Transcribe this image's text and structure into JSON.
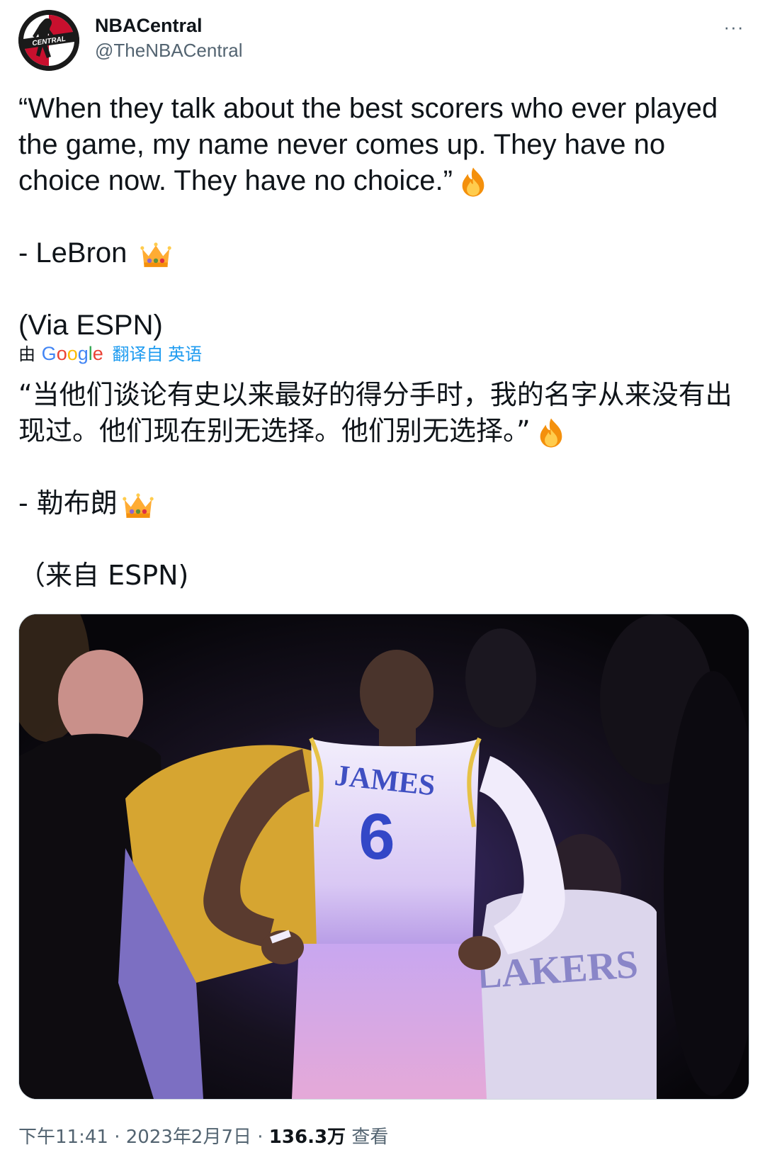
{
  "author": {
    "display_name": "NBACentral",
    "handle": "@TheNBACentral",
    "avatar_text": "CENTRAL"
  },
  "more_label": "···",
  "tweet": {
    "quote": "“When they talk about the best scorers who ever played the game, my name never comes up. They have no choice now. They have no choice.”",
    "attribution": "- LeBron",
    "source": "(Via ESPN)"
  },
  "translation": {
    "prefix": "由",
    "google": [
      "G",
      "o",
      "o",
      "g",
      "l",
      "e"
    ],
    "link": "翻译自 英语",
    "quote": "“当他们谈论有史以来最好的得分手时，我的名字从来没有出现过。他们现在别无选择。他们别无选择。”",
    "attribution": "- 勒布朗",
    "source": "（来自 ESPN)"
  },
  "media": {
    "jersey_name": "JAMES",
    "jersey_number": "6",
    "second_jersey_text": "LAKERS"
  },
  "meta": {
    "time": "下午11:41",
    "date": "2023年2月7日",
    "views_count": "136.3万",
    "views_label": "查看"
  },
  "icons": {
    "fire": "fire-icon",
    "crown": "crown-icon",
    "more": "more-icon"
  }
}
